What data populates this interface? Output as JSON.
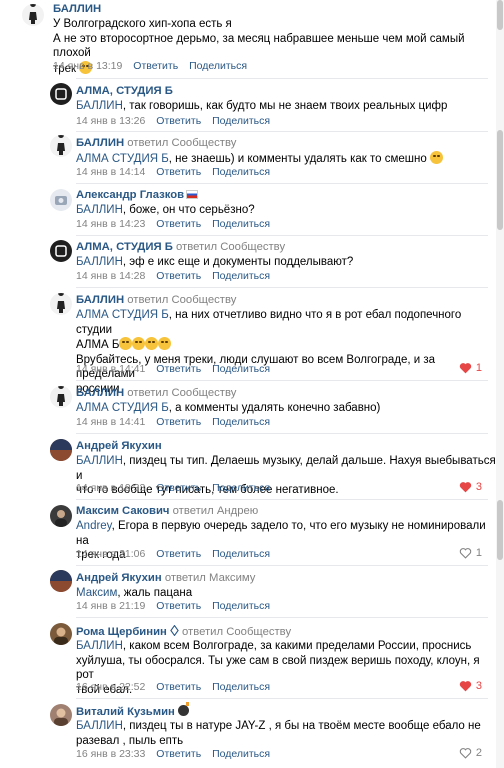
{
  "colors": {
    "link": "#2a5885",
    "meta": "#828282",
    "like_red": "#e64646"
  },
  "comments": [
    {
      "author": "БАЛЛИН",
      "replied": "",
      "lines": [
        "У Волгоградского хип-хопа есть я",
        "А не это второсортное дерьмо, за месяц набравшее меньше чем мой самый плохой",
        "трек"
      ],
      "date": "14 янв в 13:19",
      "reply": "Ответить",
      "share": "Поделиться",
      "likes": ""
    },
    {
      "author": "АЛМА, СТУДИЯ Б",
      "replied": "",
      "mention": "БАЛЛИН",
      "text": ", так говоришь, как будто мы не знаем твоих реальных цифр",
      "date": "14 янв в 13:26",
      "reply": "Ответить",
      "share": "Поделиться"
    },
    {
      "author": "БАЛЛИН",
      "replied_word": "ответил",
      "replied": "Сообществу",
      "mention": "АЛМА СТУДИЯ Б",
      "text": ", не знаешь) и комменты удалять как то смешно",
      "date": "14 янв в 14:14",
      "reply": "Ответить",
      "share": "Поделиться"
    },
    {
      "author": "Александр Глазков",
      "replied": "",
      "mention": "БАЛЛИН",
      "text": ", боже, он что серьёзно?",
      "date": "14 янв в 14:23",
      "reply": "Ответить",
      "share": "Поделиться"
    },
    {
      "author": "АЛМА, СТУДИЯ Б",
      "replied_word": "ответил",
      "replied": "Сообществу",
      "mention": "БАЛЛИН",
      "text": ", эф е икс еще и документы подделывают?",
      "date": "14 янв в 14:28",
      "reply": "Ответить",
      "share": "Поделиться"
    },
    {
      "author": "БАЛЛИН",
      "replied_word": "ответил",
      "replied": "Сообществу",
      "mention": "АЛМА СТУДИЯ Б",
      "text": ", на них отчетливо видно что я в рот ебал подопечного студии",
      "line2": "АЛМА Б",
      "line3": "Врубайтесь, у меня треки, люди слушают во всем Волгограде, и за пределами",
      "line4": "россиии",
      "date": "14 янв в 14:41",
      "reply": "Ответить",
      "share": "Поделиться",
      "likes": "1"
    },
    {
      "author": "БАЛЛИН",
      "replied_word": "ответил",
      "replied": "Сообществу",
      "mention": "АЛМА СТУДИЯ Б",
      "text": ", а комменты удалять конечно забавно)",
      "date": "14 янв в 14:41",
      "reply": "Ответить",
      "share": "Поделиться"
    },
    {
      "author": "Андрей Якухин",
      "replied": "",
      "mention": "БАЛЛИН",
      "text": ", пиздец ты тип. Делаешь музыку, делай дальше. Нахуя выебываться и",
      "line2": "что то вообще тут писать, тем более негативное.",
      "date": "14 янв в 19:33",
      "reply": "Ответить",
      "share": "Поделиться",
      "likes": "3"
    },
    {
      "author": "Максим Сакович",
      "replied_word": "ответил",
      "replied": "Андрею",
      "mention": "Andrey",
      "text": ", Егора в первую очередь задело то, что его музыку не номинировали на",
      "line2": "трек года",
      "date": "14 янв в 21:06",
      "reply": "Ответить",
      "share": "Поделиться",
      "likes": "1"
    },
    {
      "author": "Андрей Якухин",
      "replied_word": "ответил",
      "replied": "Максиму",
      "mention": "Максим",
      "text": ", жаль пацана",
      "date": "14 янв в 21:19",
      "reply": "Ответить",
      "share": "Поделиться"
    },
    {
      "author": "Рома Щербинин",
      "replied_word": "ответил",
      "replied": "Сообществу",
      "mention": "БАЛЛИН",
      "text": ", каком всем Волгограде, за какими пределами России, проснись",
      "line2": "хуйлуша, ты обосрался. Ты уже сам в свой пиздеж веришь походу, клоун, я рот",
      "line3": "твой ебал.",
      "date": "16 янв в 22:52",
      "reply": "Ответить",
      "share": "Поделиться",
      "likes": "3"
    },
    {
      "author": "Виталий Кузьмин",
      "replied": "",
      "mention": "БАЛЛИН",
      "text": ", пиздец ты в натуре JAY-Z , я бы на твоём месте вообще ебало не",
      "line2": "разевал , пыль епть",
      "date": "16 янв в 23:33",
      "reply": "Ответить",
      "share": "Поделиться",
      "likes": "2"
    }
  ]
}
